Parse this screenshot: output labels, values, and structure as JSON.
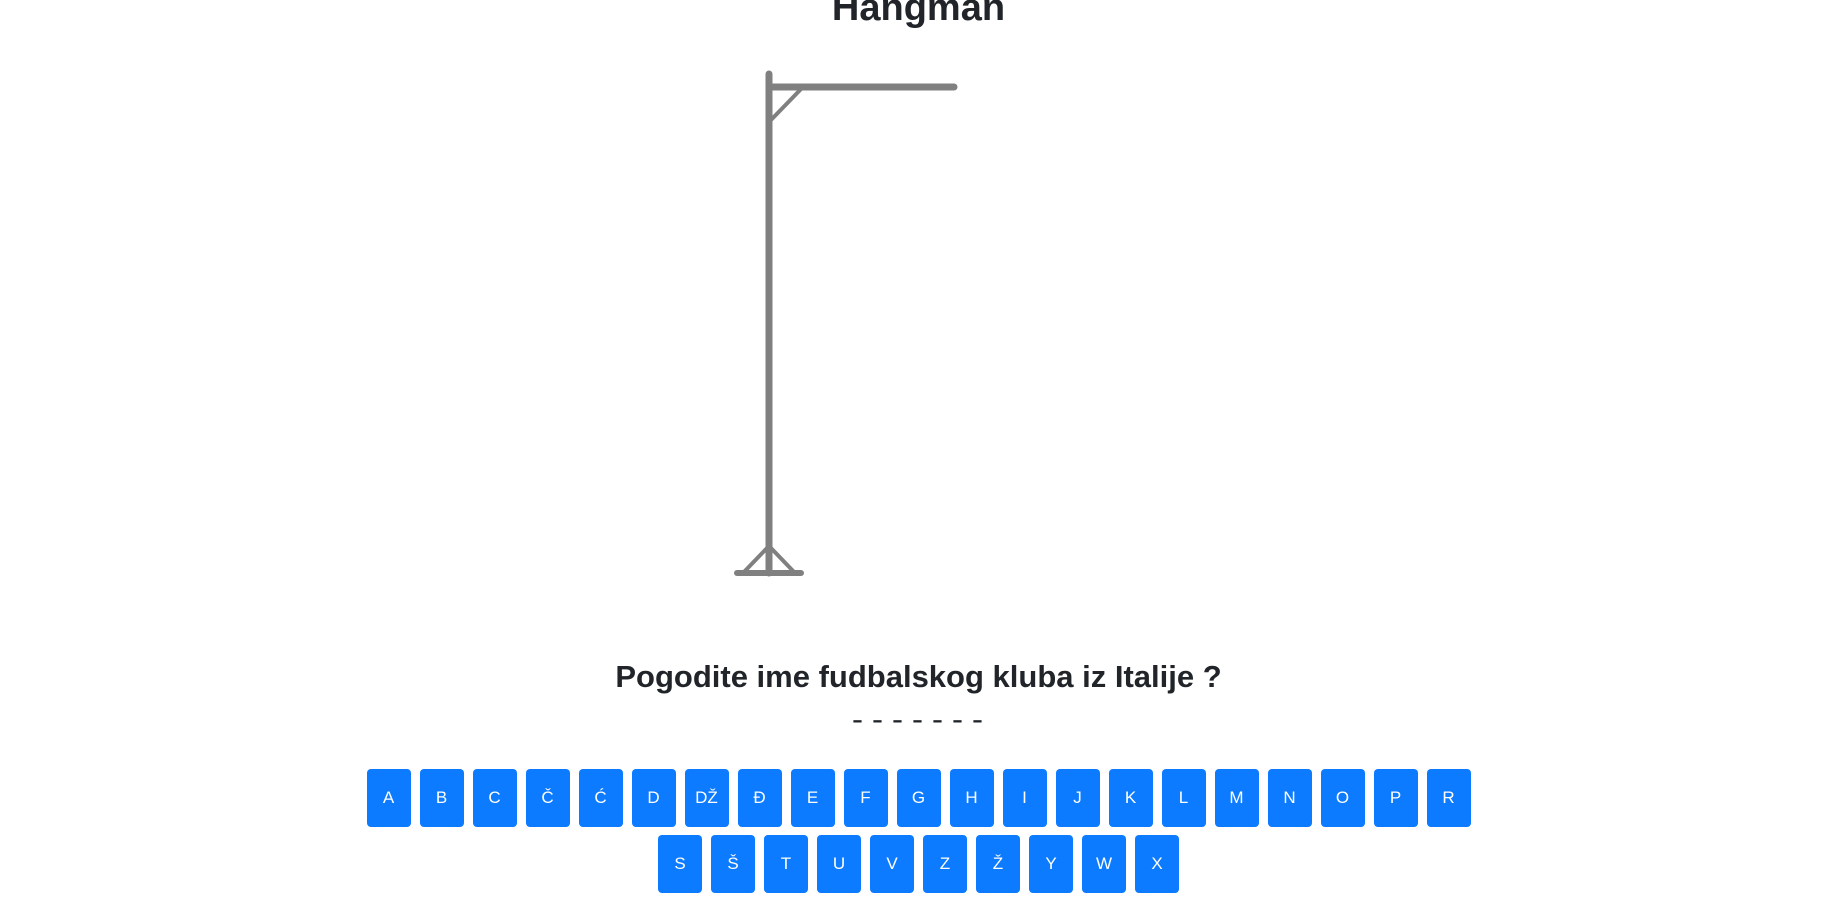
{
  "game": {
    "title": "Hangman",
    "question": "Pogodite ime fudbalskog kluba iz Italije ?",
    "masked_word": "-------",
    "wrong_guesses": 0
  },
  "keyboard": {
    "row1": [
      "A",
      "B",
      "C",
      "Č",
      "Ć",
      "D",
      "DŽ",
      "Đ",
      "E",
      "F",
      "G",
      "H",
      "I",
      "J",
      "K",
      "L",
      "M",
      "N",
      "O",
      "P",
      "R"
    ],
    "row2": [
      "S",
      "Š",
      "T",
      "U",
      "V",
      "Z",
      "Ž",
      "Y",
      "W",
      "X"
    ]
  },
  "colors": {
    "key_background": "#0d7bff",
    "key_text": "#ffffff",
    "gallows": "#808080",
    "text": "#212529"
  }
}
